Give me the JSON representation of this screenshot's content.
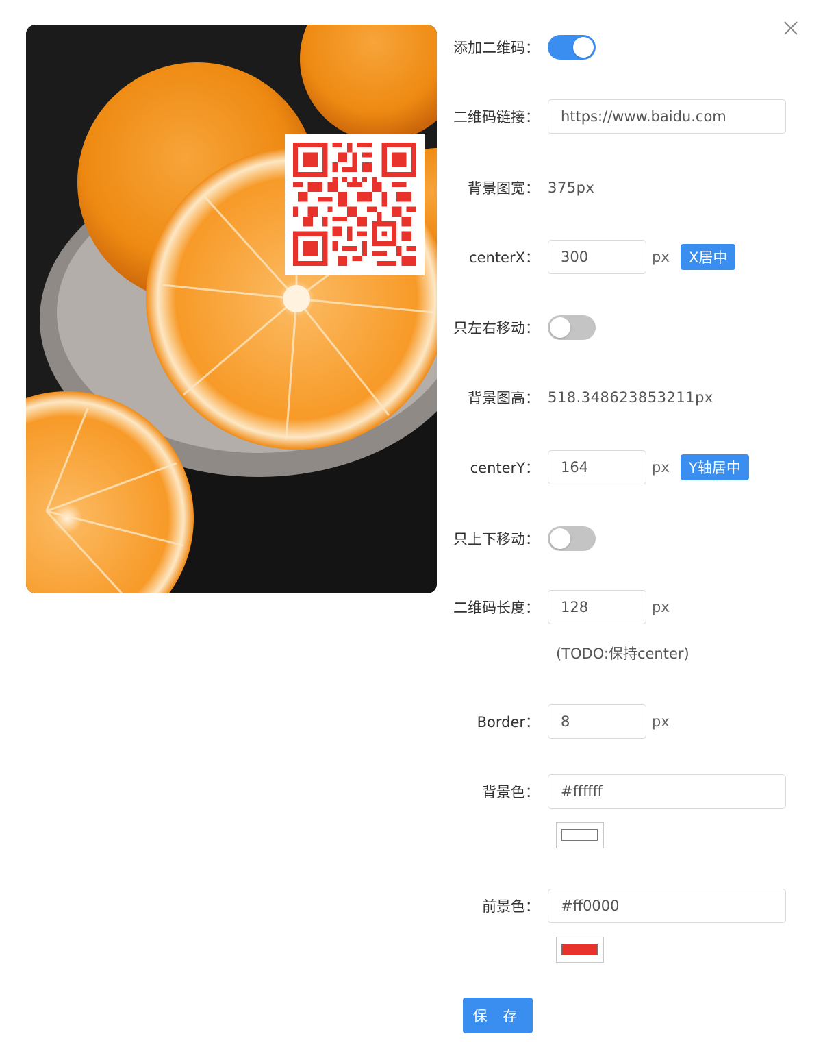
{
  "form": {
    "add_qr": {
      "label": "添加二维码：",
      "enabled": true
    },
    "qr_link": {
      "label": "二维码链接：",
      "value": "https://www.baidu.com"
    },
    "bg_width": {
      "label": "背景图宽：",
      "value": "375px"
    },
    "center_x": {
      "label": "centerX：",
      "value": "300",
      "unit": "px",
      "button": "X居中"
    },
    "only_horizontal": {
      "label": "只左右移动：",
      "enabled": false
    },
    "bg_height": {
      "label": "背景图高：",
      "value": "518.348623853211px"
    },
    "center_y": {
      "label": "centerY：",
      "value": "164",
      "unit": "px",
      "button": "Y轴居中"
    },
    "only_vertical": {
      "label": "只上下移动：",
      "enabled": false
    },
    "qr_size": {
      "label": "二维码长度：",
      "value": "128",
      "unit": "px",
      "note": "(TODO:保持center)"
    },
    "border": {
      "label": "Border：",
      "value": "8",
      "unit": "px"
    },
    "bg_color": {
      "label": "背景色：",
      "value": "#ffffff",
      "swatch": "#ffffff"
    },
    "fg_color": {
      "label": "前景色：",
      "value": "#ff0000",
      "swatch": "#e8322c"
    },
    "save_label": "保 存"
  },
  "colors": {
    "primary": "#3a8ef0",
    "qr_foreground": "#e8322c"
  },
  "icons": {
    "close": "close-icon"
  }
}
